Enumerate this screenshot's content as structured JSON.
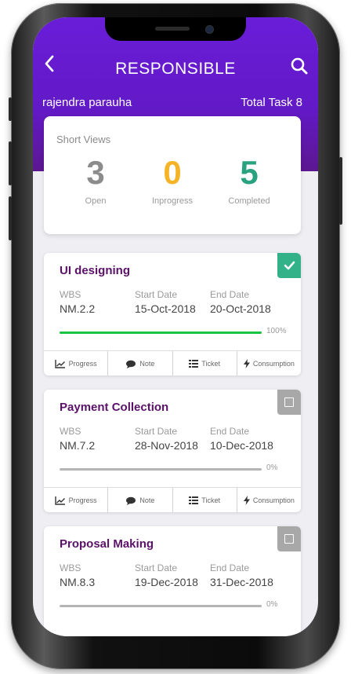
{
  "header": {
    "title": "RESPONSIBLE",
    "back_icon": "chevron-left-icon",
    "search_icon": "search-icon",
    "user_name": "rajendra parauha",
    "total_task": "Total Task 8"
  },
  "summary": {
    "label": "Short Views",
    "stats": [
      {
        "value": "3",
        "label": "Open",
        "color": "#8c8c8c"
      },
      {
        "value": "0",
        "label": "Inprogress",
        "color": "#f5b428"
      },
      {
        "value": "5",
        "label": "Completed",
        "color": "#2aa27f"
      }
    ]
  },
  "field_labels": {
    "wbs": "WBS",
    "start": "Start Date",
    "end": "End Date"
  },
  "actions": [
    "Progress",
    "Note",
    "Ticket",
    "Consumption"
  ],
  "tasks": [
    {
      "name": "UI designing",
      "wbs": "NM.2.2",
      "start_date": "15-Oct-2018",
      "end_date": "20-Oct-2018",
      "progress": 100,
      "progress_label": "100%",
      "completed": true
    },
    {
      "name": "Payment Collection",
      "wbs": "NM.7.2",
      "start_date": "28-Nov-2018",
      "end_date": "10-Dec-2018",
      "progress": 0,
      "progress_label": "0%",
      "completed": false
    },
    {
      "name": "Proposal Making",
      "wbs": "NM.8.3",
      "start_date": "19-Dec-2018",
      "end_date": "31-Dec-2018",
      "progress": 0,
      "progress_label": "0%",
      "completed": false
    }
  ]
}
